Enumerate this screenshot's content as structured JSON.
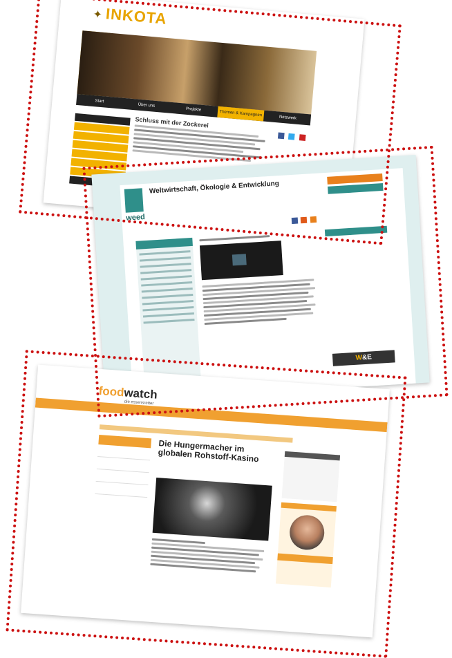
{
  "inkota": {
    "logo": "INKOTA",
    "nav": [
      "Start",
      "Über uns",
      "Projekte",
      "Themen & Kampagnen",
      "Netzwerk"
    ],
    "headline": "Schluss mit der Zockerei"
  },
  "weed": {
    "logo": "weed",
    "title": "Weltwirtschaft, Ökologie & Entwicklung",
    "we_badge_w": "W",
    "we_badge_rest": "&E"
  },
  "foodwatch": {
    "logo_food": "food",
    "logo_watch": "watch",
    "logo_sub": "die essensretter",
    "headline": "Die Hungermacher im globalen Rohstoff-Kasino"
  },
  "colors": {
    "inkota_accent": "#f2b200",
    "weed_accent": "#2f8f8a",
    "foodwatch_accent": "#f0a030",
    "frame_dots": "#cc1111"
  }
}
